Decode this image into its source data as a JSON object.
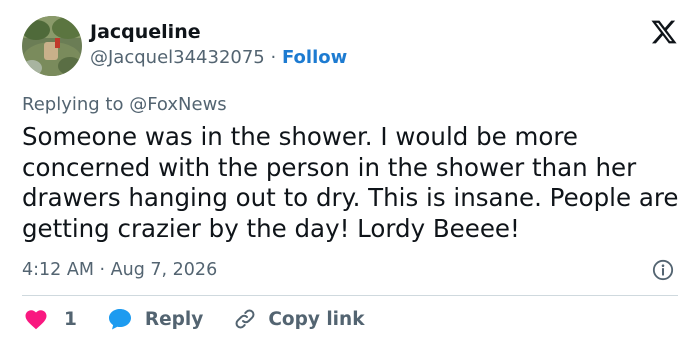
{
  "author": {
    "display_name": "Jacqueline",
    "handle": "@Jacquel34432075",
    "separator": "·",
    "follow_label": "Follow"
  },
  "reply_context": {
    "prefix": "Replying to",
    "mention": "@FoxNews"
  },
  "tweet": {
    "text": "Someone was in the shower.  I would be more concerned with the person in the shower than her drawers hanging out to dry.  This is insane. People are getting crazier by the day!  Lordy Beeee!",
    "time": "4:12 AM",
    "separator": "·",
    "date": "Aug 7, 2026"
  },
  "actions": {
    "like_count": "1",
    "reply_label": "Reply",
    "copy_label": "Copy link"
  },
  "icons": {
    "brand": "x-logo-icon",
    "info": "info-icon",
    "like": "heart-icon",
    "reply": "speech-bubble-icon",
    "copy": "link-icon"
  },
  "colors": {
    "follow": "#1d7bd1",
    "like": "#f91880",
    "reply": "#1d9bf0",
    "muted": "#536471",
    "divider": "#cfd9de"
  }
}
